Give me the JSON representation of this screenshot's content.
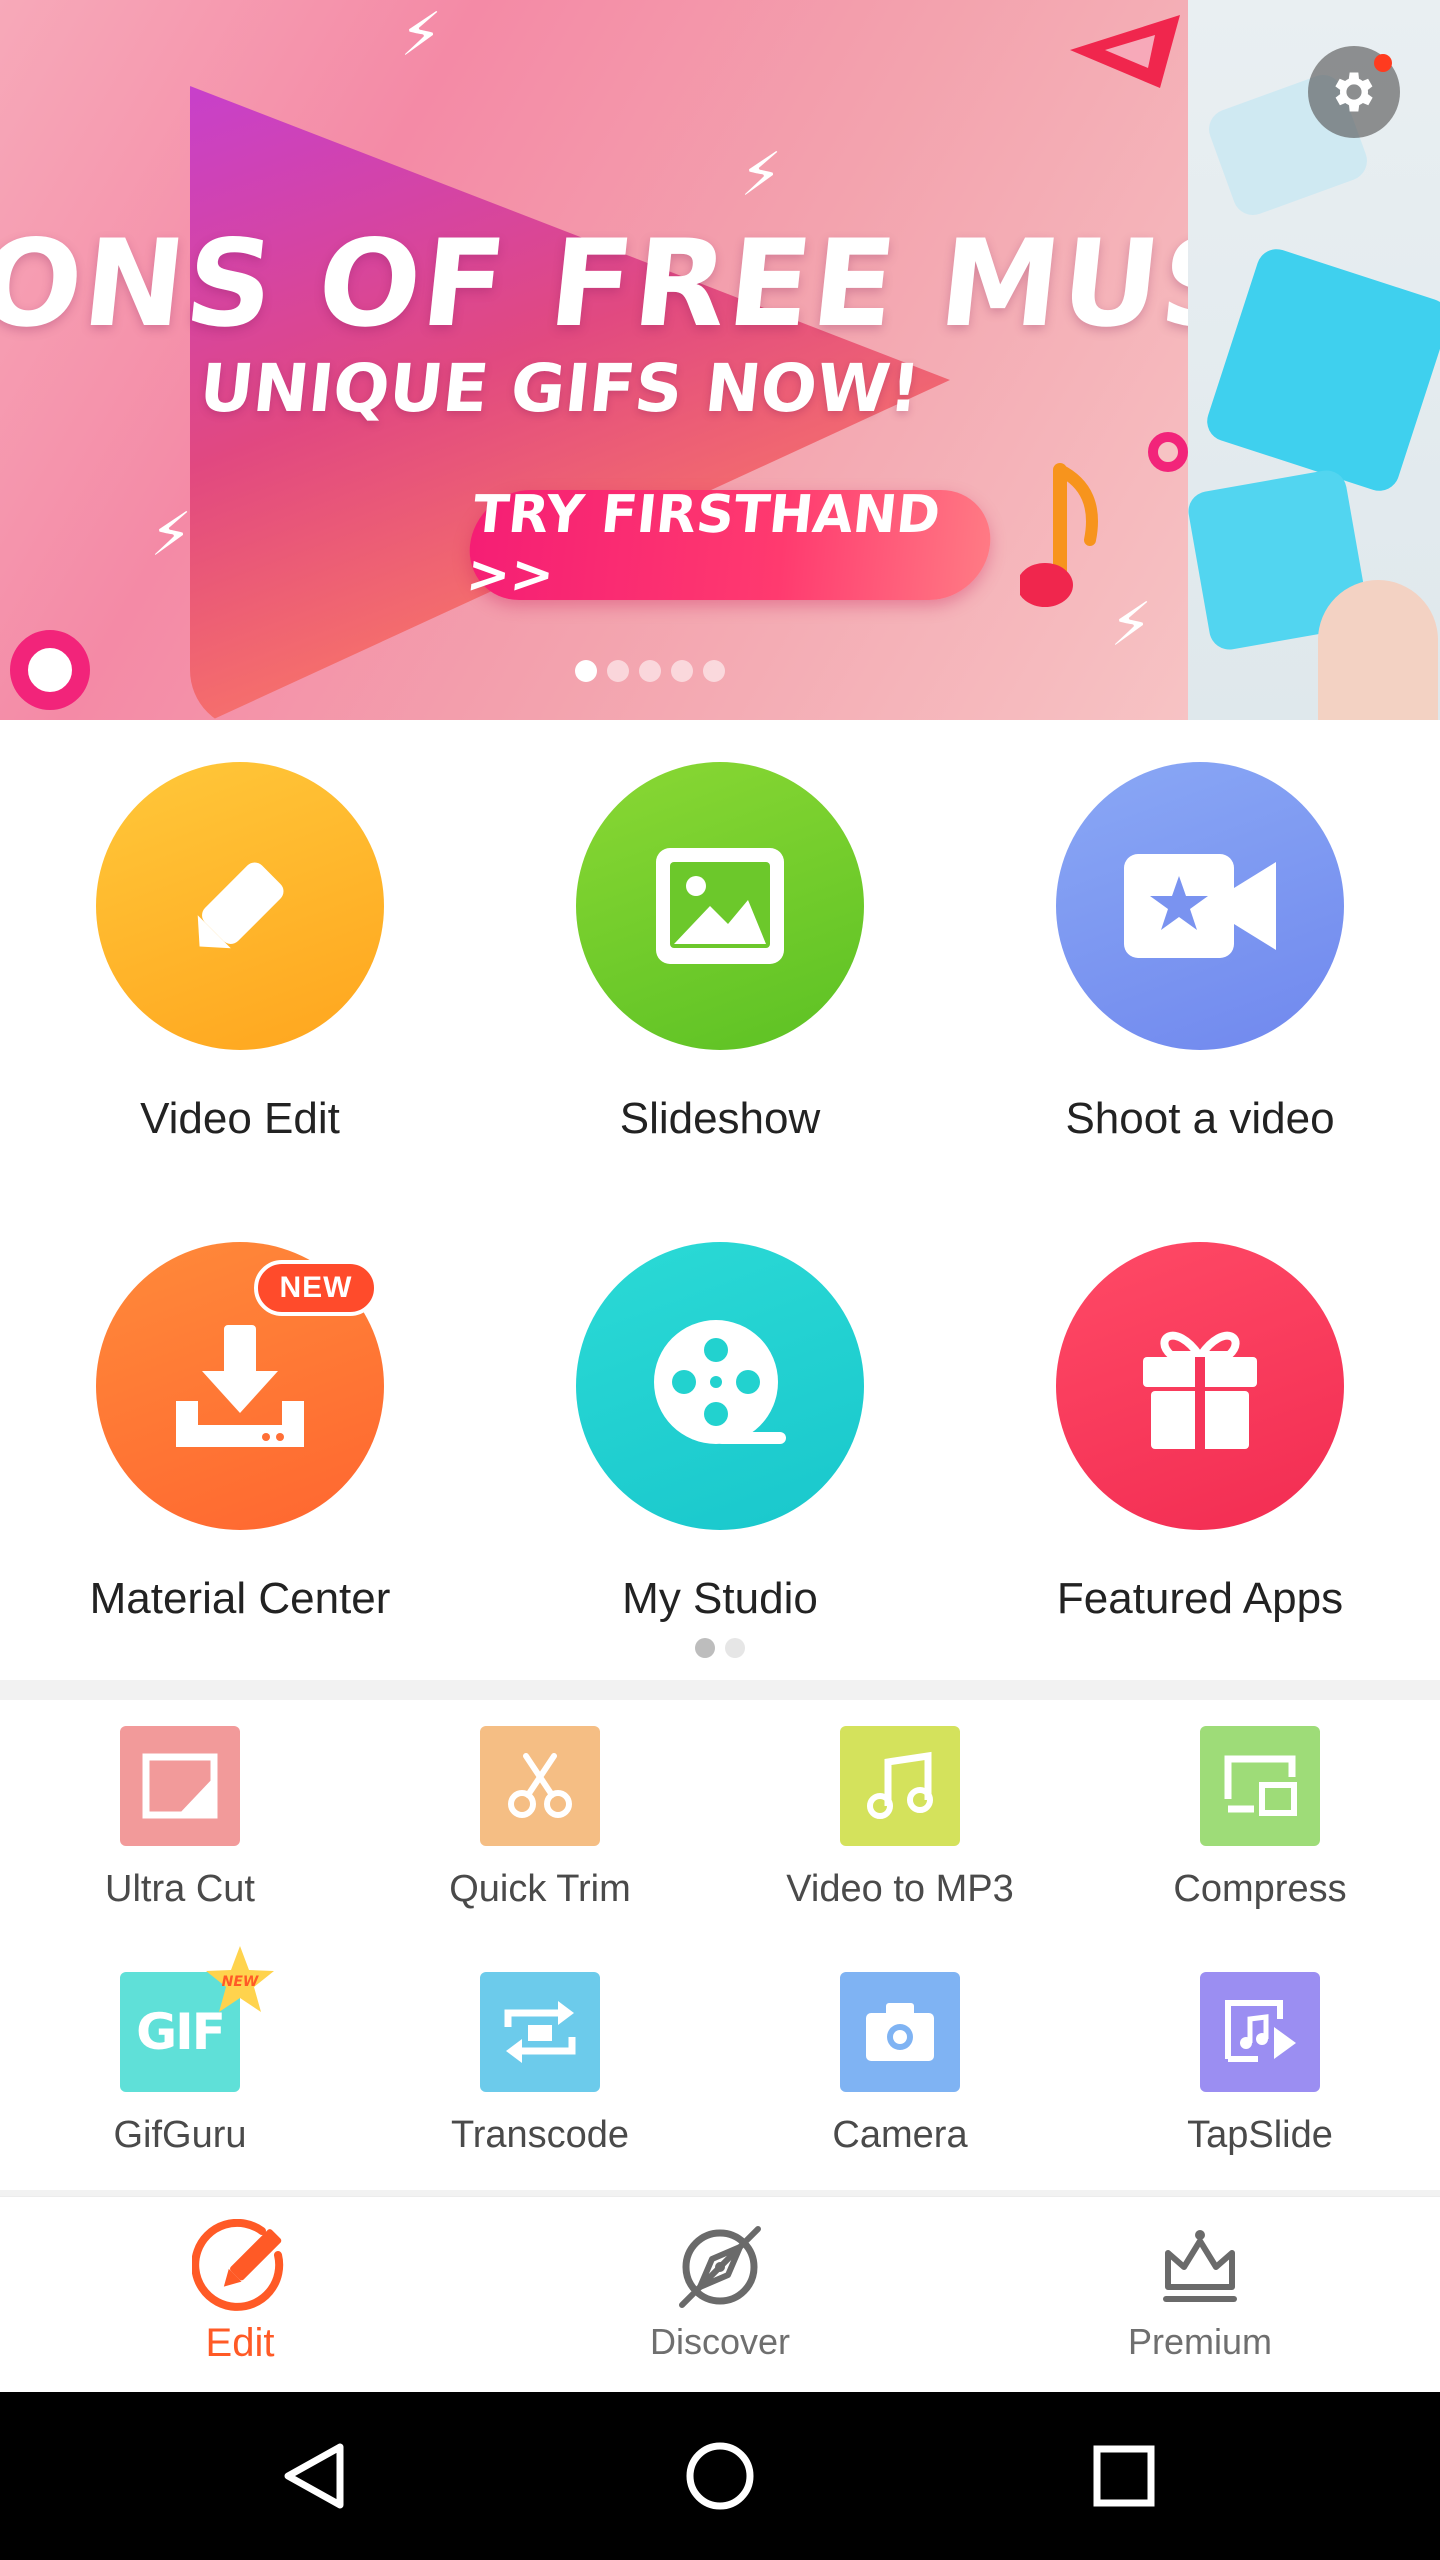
{
  "banner": {
    "line1": "ONS OF FREE MUSIC",
    "line2": "UNIQUE GIFS NOW!",
    "cta": "TRY FIRSTHAND >>",
    "page_count": 5,
    "active_page": 1
  },
  "features": {
    "items": [
      {
        "label": "Video Edit",
        "color": "#FFB324",
        "icon": "pencil-icon"
      },
      {
        "label": "Slideshow",
        "color": "#6FCB2D",
        "icon": "image-icon"
      },
      {
        "label": "Shoot a video",
        "color": "#7D95F2",
        "icon": "video-camera-icon"
      },
      {
        "label": "Material Center",
        "color": "#FF6F36",
        "icon": "download-icon",
        "badge": "NEW"
      },
      {
        "label": "My Studio",
        "color": "#22D2CF",
        "icon": "film-reel-icon"
      },
      {
        "label": "Featured Apps",
        "color": "#F6365A",
        "icon": "gift-icon"
      }
    ],
    "page_count": 2,
    "active_page": 1
  },
  "tools": {
    "items": [
      {
        "label": "Ultra Cut",
        "color": "#F29A9A",
        "icon": "crop-icon"
      },
      {
        "label": "Quick Trim",
        "color": "#F5BE84",
        "icon": "scissors-icon"
      },
      {
        "label": "Video to MP3",
        "color": "#D4E25C",
        "icon": "music-note-icon"
      },
      {
        "label": "Compress",
        "color": "#9EDC78",
        "icon": "compress-icon"
      },
      {
        "label": "GifGuru",
        "color": "#5FE0D8",
        "icon": "gif-icon",
        "badge": "NEW"
      },
      {
        "label": "Transcode",
        "color": "#6CCBEB",
        "icon": "transcode-icon"
      },
      {
        "label": "Camera",
        "color": "#7FB3F3",
        "icon": "camera-icon"
      },
      {
        "label": "TapSlide",
        "color": "#9B8EF2",
        "icon": "tapslide-icon"
      }
    ]
  },
  "bottom_nav": {
    "items": [
      {
        "label": "Edit",
        "active": true,
        "icon": "edit-icon"
      },
      {
        "label": "Discover",
        "active": false,
        "icon": "compass-icon"
      },
      {
        "label": "Premium",
        "active": false,
        "icon": "crown-icon"
      }
    ],
    "active_color": "#FF5A26"
  },
  "system_bar": {
    "buttons": [
      "back-icon",
      "home-icon",
      "recents-icon"
    ]
  }
}
